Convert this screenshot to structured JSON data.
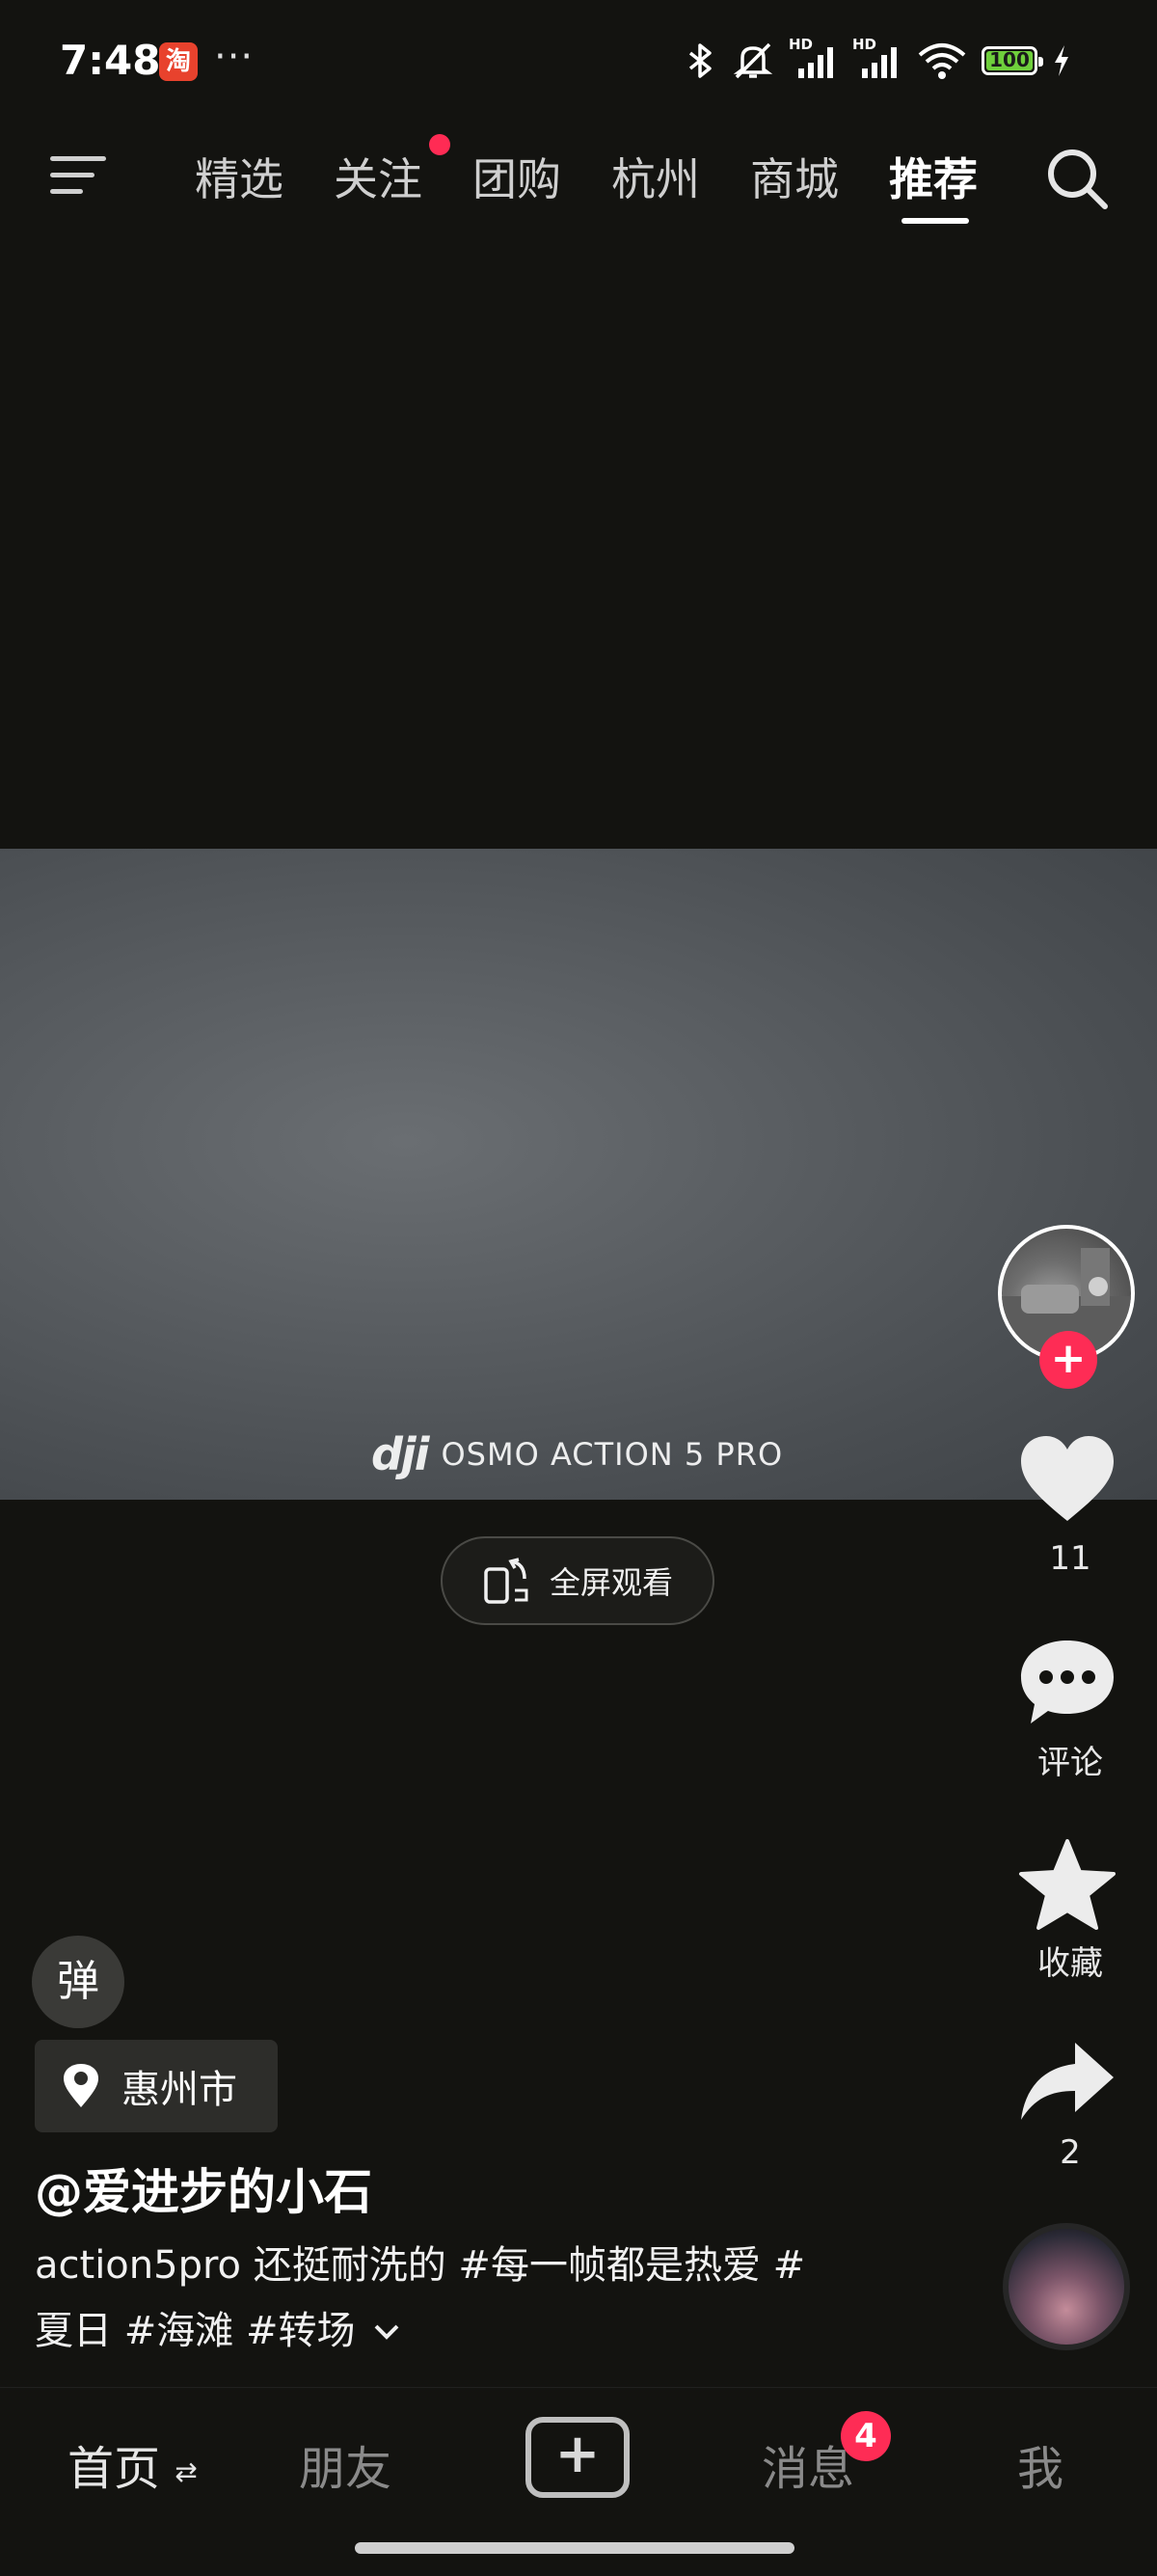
{
  "status_bar": {
    "time": "7:48",
    "app_badge": "淘",
    "more": "···",
    "battery": "100",
    "network_labels": [
      "HD",
      "HD"
    ]
  },
  "top_nav": {
    "tabs": [
      {
        "label": "精选"
      },
      {
        "label": "关注"
      },
      {
        "label": "团购"
      },
      {
        "label": "杭州"
      },
      {
        "label": "商城"
      },
      {
        "label": "推荐"
      }
    ],
    "active_tab": "推荐"
  },
  "video": {
    "watermark_brand": "dji",
    "watermark_text": "OSMO ACTION 5 PRO",
    "fullscreen_label": "全屏观看"
  },
  "actions": {
    "like_count": "11",
    "comment_label": "评论",
    "favorite_label": "收藏",
    "share_count": "2"
  },
  "post": {
    "danmu_label": "弹",
    "location": "惠州市",
    "author": "@爱进步的小石",
    "description_line1": "action5pro 还挺耐洗的 #每一帧都是热爱 #",
    "description_line2": "夏日 #海滩 #转场"
  },
  "bottom_nav": {
    "home": "首页",
    "friends": "朋友",
    "messages": "消息",
    "messages_badge": "4",
    "me": "我"
  },
  "colors": {
    "background": "#131310",
    "accent_red": "#fe2c55",
    "battery_green": "#6fcf3c"
  }
}
